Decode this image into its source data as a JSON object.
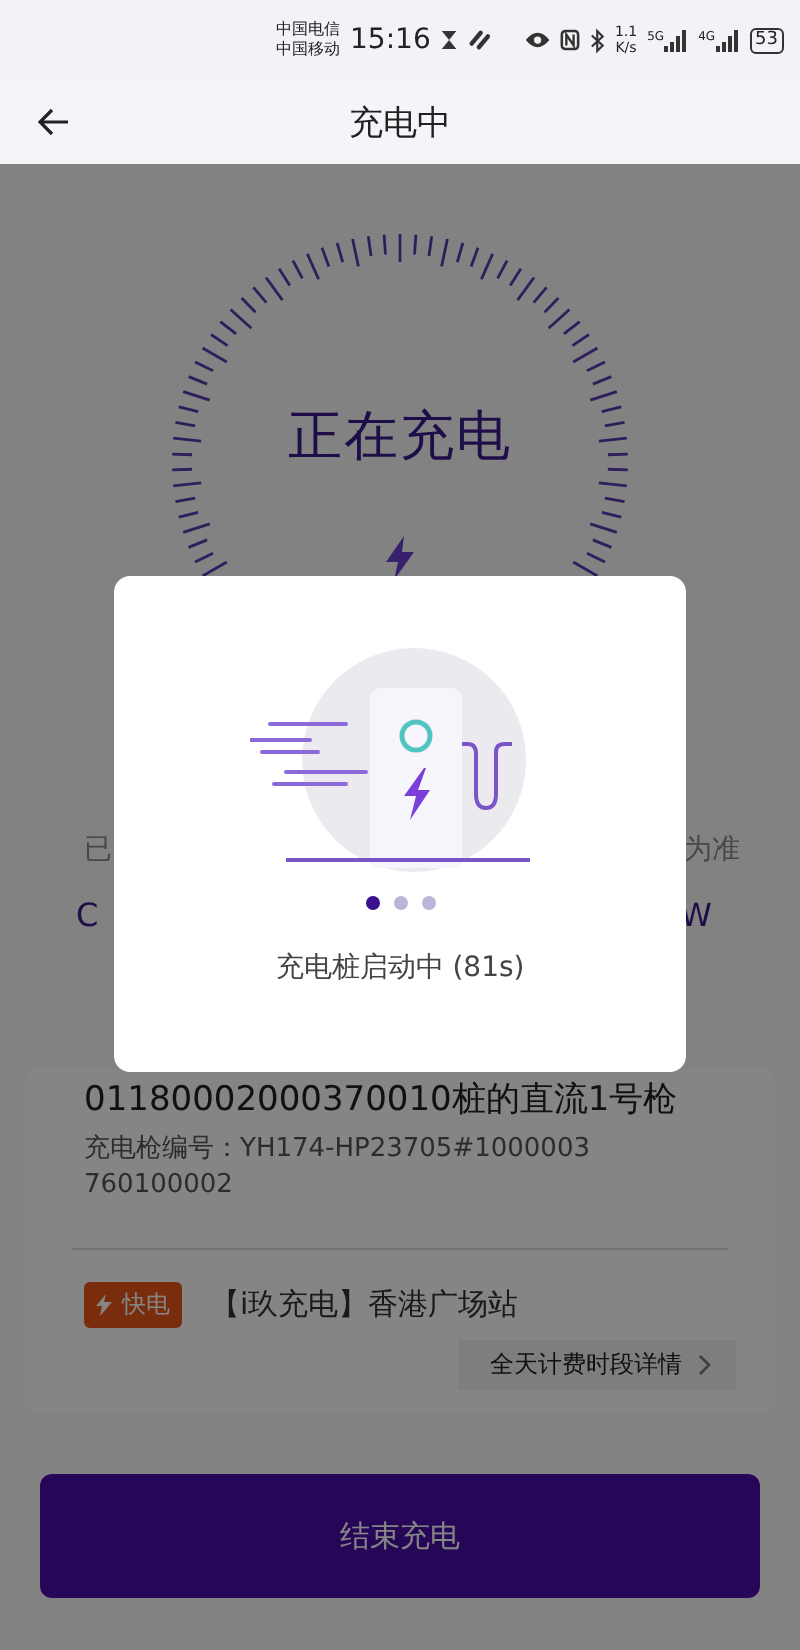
{
  "status_bar": {
    "carriers": [
      "中国电信",
      "中国移动"
    ],
    "time": "15:16",
    "speed": [
      "1.1",
      "K/s"
    ],
    "signals": [
      "5G",
      "4G"
    ],
    "battery": "53"
  },
  "header": {
    "title": "充电中"
  },
  "gauge": {
    "status": "正在充电"
  },
  "info_row": {
    "left": "已",
    "right": "为准"
  },
  "stats_row": {
    "left": "C",
    "right": "W"
  },
  "card": {
    "title": "01180002000370010桩的直流1号枪",
    "gun_number": "充电枪编号：YH174-HP23705#1000003760100002",
    "tag": "快电",
    "station": "【i玖充电】香港广场站",
    "pricing_link": "全天计费时段详情"
  },
  "end_button": "结束充电",
  "modal": {
    "message": "充电桩启动中 (81s)",
    "pages": [
      {
        "selected": true
      },
      {
        "selected": false
      },
      {
        "selected": false
      }
    ]
  }
}
